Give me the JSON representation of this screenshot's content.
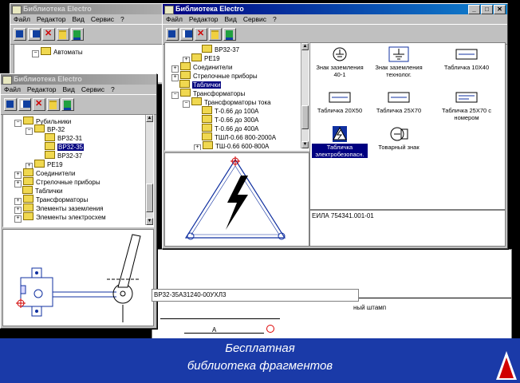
{
  "app": {
    "title": "Библиотека Electro"
  },
  "menu": [
    "Файл",
    "Редактор",
    "Вид",
    "Сервис",
    "?"
  ],
  "back_window": {
    "tree": [
      {
        "label": "Автоматы",
        "level": 1
      }
    ]
  },
  "left_window": {
    "tree": [
      {
        "label": "Рубильники",
        "pm": "−"
      },
      {
        "label": "ВР-32",
        "pm": "−"
      },
      {
        "label": "ВР32-31",
        "pm": ""
      },
      {
        "label": "ВР32-35",
        "pm": "",
        "selected": true
      },
      {
        "label": "ВР32-37",
        "pm": ""
      },
      {
        "label": "РЕ19",
        "pm": "+"
      },
      {
        "label": "Соединители",
        "pm": "+"
      },
      {
        "label": "Стрелочные приборы",
        "pm": "+"
      },
      {
        "label": "Таблички",
        "pm": ""
      },
      {
        "label": "Трансформаторы",
        "pm": "+"
      },
      {
        "label": "Элементы заземления",
        "pm": "+"
      },
      {
        "label": "Элементы электросхем",
        "pm": "+"
      }
    ],
    "drawing_label": "ВР32-35А31240-00УХЛ3"
  },
  "right_window": {
    "tree": [
      {
        "label": "ВР32-37",
        "pm": ""
      },
      {
        "label": "РЕ19",
        "pm": "+"
      },
      {
        "label": "Соединители",
        "pm": "+"
      },
      {
        "label": "Стрелочные приборы",
        "pm": "+"
      },
      {
        "label": "Таблички",
        "pm": "",
        "selected": true
      },
      {
        "label": "Трансформаторы",
        "pm": "−"
      },
      {
        "label": "Трансформаторы тока",
        "pm": "−"
      },
      {
        "label": "Т-0.66  до 100А",
        "pm": ""
      },
      {
        "label": "Т-0.66  до 300А",
        "pm": ""
      },
      {
        "label": "Т-0.66  до 400А",
        "pm": ""
      },
      {
        "label": "ТШЛ-0.66 800-2000А",
        "pm": ""
      },
      {
        "label": "ТШ-0.66  600-800А",
        "pm": "+"
      }
    ],
    "symbols": [
      {
        "label": "Знак заземления 40-1",
        "icon": "ground-sign-icon"
      },
      {
        "label": "Знак заземления технолог.",
        "icon": "ground-tech-icon"
      },
      {
        "label": "Табличка 10Х40",
        "icon": "plate-icon"
      },
      {
        "label": "Табличка 20Х50",
        "icon": "plate-icon"
      },
      {
        "label": "Табличка 25Х70",
        "icon": "plate-icon"
      },
      {
        "label": "Табличка 25Х70 с номером",
        "icon": "plate-number-icon"
      },
      {
        "label": "Табличка электробезопасн.",
        "icon": "lightning-icon",
        "selected": true
      },
      {
        "label": "Товарный знак",
        "icon": "trademark-icon"
      }
    ],
    "code_label": "ЕИЛА 754341.001-01"
  },
  "back_lower": {
    "stamp_label": "ный штамп",
    "dim_label": "А"
  },
  "banner": {
    "line1": "Бесплатная",
    "line2": "библиотека фрагментов"
  },
  "colors": {
    "title_active": "#000080",
    "banner": "#1a3aa8",
    "selection": "#000080"
  }
}
